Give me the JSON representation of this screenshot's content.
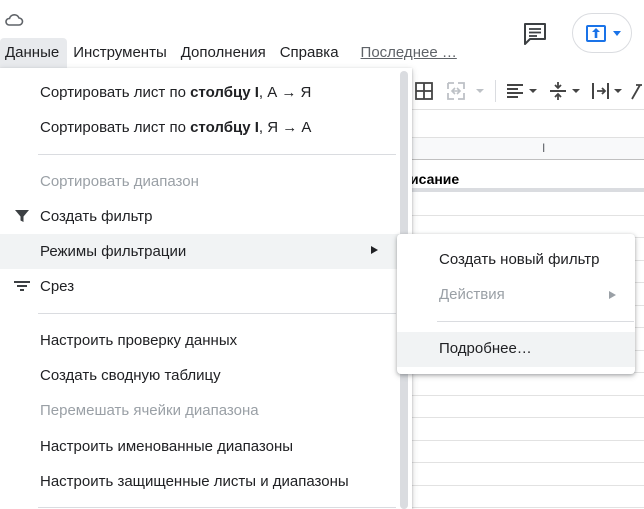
{
  "menubar": {
    "items": [
      {
        "label": "Данные",
        "active": true
      },
      {
        "label": "Инструменты"
      },
      {
        "label": "Дополнения"
      },
      {
        "label": "Справка"
      }
    ],
    "last_edit": "Последнее …"
  },
  "grid": {
    "column_letter": "I",
    "header_text": "исание"
  },
  "data_menu": {
    "sort_az": {
      "prefix": "Сортировать лист по ",
      "bold": "столбцу I",
      "suffix": ", А → Я"
    },
    "sort_za": {
      "prefix": "Сортировать лист по ",
      "bold": "столбцу I",
      "suffix": ", Я → А"
    },
    "sort_range": "Сортировать диапазон",
    "create_filter": "Создать фильтр",
    "filter_views": "Режимы фильтрации",
    "slicer": "Срез",
    "data_validation": "Настроить проверку данных",
    "pivot_table": "Создать сводную таблицу",
    "randomize_range": "Перемешать ячейки диапазона",
    "named_ranges": "Настроить именованные диапазоны",
    "protected_sheets": "Настроить защищенные листы и диапазоны"
  },
  "filter_views_submenu": {
    "create_new": "Создать новый фильтр",
    "actions": "Действия",
    "more": "Подробнее…"
  },
  "colors": {
    "accent": "#1a73e8",
    "disabled_text": "#9aa0a6",
    "hover_bg": "#f1f3f4"
  }
}
